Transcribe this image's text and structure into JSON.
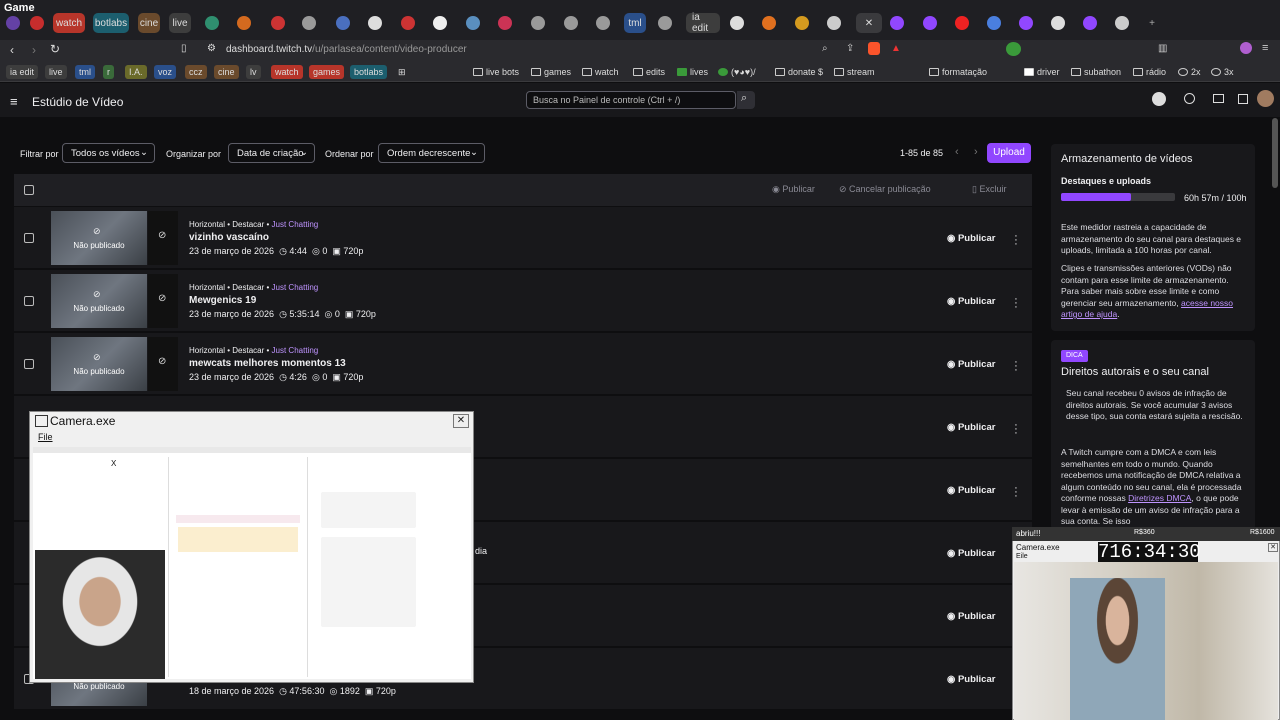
{
  "window": {
    "title": "Game"
  },
  "tabs": [
    {
      "label": "watch",
      "color": "#b7352a"
    },
    {
      "label": "botlabs",
      "color": "#1c5e6e"
    },
    {
      "label": "cine",
      "color": "#6a4a2c"
    },
    {
      "label": "live",
      "color": "#3d3d3d"
    },
    {
      "label": "tml",
      "color": "#2a4f8a"
    },
    {
      "label": "ia edit",
      "color": "#3d3d3d"
    }
  ],
  "address": {
    "host": "dashboard.twitch.tv",
    "path": "/u/parlasea/content/video-producer"
  },
  "bookmarks": {
    "pills": [
      {
        "label": "ia edit",
        "color": "#3d3d3d"
      },
      {
        "label": "live",
        "color": "#3d3d3d"
      },
      {
        "label": "tml",
        "color": "#2a4f8a"
      },
      {
        "label": "r",
        "color": "#3a6a3a"
      },
      {
        "label": "I.A.",
        "color": "#6a6a2a"
      },
      {
        "label": "voz",
        "color": "#2a4f8a"
      },
      {
        "label": "ccz",
        "color": "#6a4a2c"
      },
      {
        "label": "cine",
        "color": "#6a4a2c"
      },
      {
        "label": "lv",
        "color": "#3d3d3d"
      },
      {
        "label": "watch",
        "color": "#b7352a"
      },
      {
        "label": "games",
        "color": "#b7352a"
      },
      {
        "label": "botlabs",
        "color": "#1c5e6e"
      }
    ],
    "folders": [
      "live bots",
      "games",
      "watch",
      "edits",
      "lives",
      "(♥◕♥)/",
      "donate $",
      "stream",
      "formatação",
      "driver",
      "subathon",
      "rádio",
      "2x",
      "3x"
    ]
  },
  "header": {
    "studio_title": "Estúdio de Vídeo",
    "search_placeholder": "Busca no Painel de controle (Ctrl + /)"
  },
  "filters": {
    "filter_label": "Filtrar por",
    "filter_value": "Todos os vídeos",
    "organize_label": "Organizar por",
    "organize_value": "Data de criação",
    "order_label": "Ordenar por",
    "order_value": "Ordem decrescente",
    "range": "1-85 de 85",
    "upload": "Upload"
  },
  "table_actions": {
    "publish": "Publicar",
    "cancel": "Cancelar publicação",
    "delete": "Excluir"
  },
  "rows": [
    {
      "meta": "Horizontal • Destacar • ",
      "category": "Just Chatting",
      "title": "vizinho vascaíno",
      "date": "23 de março de 2026",
      "duration": "4:44",
      "views": "0",
      "quality": "720p",
      "status": "Não publicado",
      "action": "Publicar"
    },
    {
      "meta": "Horizontal • Destacar • ",
      "category": "Just Chatting",
      "title": "Mewgenics 19",
      "date": "23 de março de 2026",
      "duration": "5:35:14",
      "views": "0",
      "quality": "720p",
      "status": "Não publicado",
      "action": "Publicar"
    },
    {
      "meta": "Horizontal • Destacar • ",
      "category": "Just Chatting",
      "title": "mewcats melhores momentos 13",
      "date": "23 de março de 2026",
      "duration": "4:26",
      "views": "0",
      "quality": "720p",
      "status": "Não publicado",
      "action": "Publicar"
    },
    {
      "action": "Publicar"
    },
    {
      "action": "Publicar"
    },
    {
      "action": "Publicar",
      "fragment": "dia"
    },
    {
      "action": "Publicar"
    },
    {
      "date": "18 de março de 2026",
      "duration": "47:56:30",
      "views": "1892",
      "quality": "720p",
      "status": "Não publicado",
      "action": "Publicar"
    }
  ],
  "storage": {
    "title": "Armazenamento de vídeos",
    "subtitle": "Destaques e uploads",
    "usage_text": "60h 57m / 100h",
    "usage_fraction": 0.61,
    "para1": "Este medidor rastreia a capacidade de armazenamento do seu canal para destaques e uploads, limitada a 100 horas por canal.",
    "para2": "Clipes e transmissões anteriores (VODs) não contam para esse limite de armazenamento. Para saber mais sobre esse limite e como gerenciar seu armazenamento,",
    "link": "acesse nosso artigo de ajuda",
    "end": "."
  },
  "tip": {
    "badge": "DICA",
    "title": "Direitos autorais e o seu canal",
    "para1": "Seu canal recebeu 0 avisos de infração de direitos autorais. Se você acumular 3 avisos desse tipo, sua conta estará sujeita a rescisão.",
    "para2": "A Twitch cumpre com a DMCA e com leis semelhantes em todo o mundo. Quando recebemos uma notificação de DMCA relativa a algum conteúdo no seu canal, ela é processada conforme nossas",
    "link": "Diretrizes DMCA",
    "para3": ", o que pode levar à emissão de um aviso de infração para a sua conta. Se isso"
  },
  "camera1": {
    "title": "Camera.exe",
    "menu": "File",
    "close": "✕"
  },
  "camera2": {
    "ticker": "abriu!!!",
    "r1": "R$360",
    "r2": "R$1600",
    "title": "Camera.exe",
    "menu": "Eile",
    "timer": "716:34:30"
  }
}
